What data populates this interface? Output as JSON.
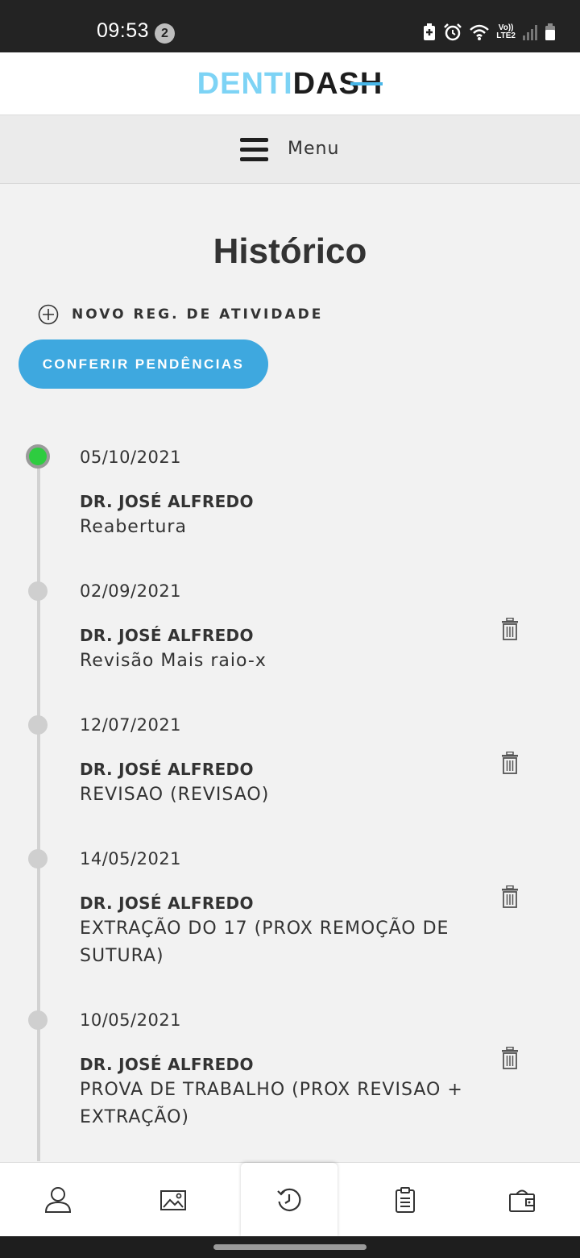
{
  "status_bar": {
    "time": "09:53",
    "notification_count": "2",
    "network": "LTE2",
    "volte": "Vo))"
  },
  "header": {
    "logo_part1": "DENTI",
    "logo_part2": "DASH",
    "logo_colors": {
      "part1": "#7dd3f5",
      "part2": "#1d1d1d",
      "accent": "#47b6e8"
    }
  },
  "menu": {
    "label": "Menu",
    "icon": "hamburger-icon"
  },
  "page": {
    "title": "Histórico",
    "new_record_label": "NOVO REG. DE ATIVIDADE",
    "pending_button_label": "CONFERIR PENDÊNCIAS",
    "accent_color": "#3ea8df"
  },
  "timeline": [
    {
      "date": "05/10/2021",
      "doctor": "DR. JOSÉ ALFREDO",
      "description": "Reabertura",
      "active": true,
      "deletable": false
    },
    {
      "date": "02/09/2021",
      "doctor": "DR. JOSÉ ALFREDO",
      "description": "Revisão Mais raio-x",
      "active": false,
      "deletable": true
    },
    {
      "date": "12/07/2021",
      "doctor": "DR. JOSÉ ALFREDO",
      "description": "REVISAO (REVISAO)",
      "active": false,
      "deletable": true
    },
    {
      "date": "14/05/2021",
      "doctor": "DR. JOSÉ ALFREDO",
      "description": "EXTRAÇÃO DO 17 (PROX REMOÇÃO DE SUTURA)",
      "active": false,
      "deletable": true
    },
    {
      "date": "10/05/2021",
      "doctor": "DR. JOSÉ ALFREDO",
      "description": "PROVA DE TRABALHO (PROX REVISAO + EXTRAÇÃO)",
      "active": false,
      "deletable": true
    }
  ],
  "bottom_nav": [
    {
      "icon": "user-icon",
      "active": false
    },
    {
      "icon": "image-icon",
      "active": false
    },
    {
      "icon": "history-icon",
      "active": true
    },
    {
      "icon": "clipboard-icon",
      "active": false
    },
    {
      "icon": "wallet-icon",
      "active": false
    }
  ]
}
